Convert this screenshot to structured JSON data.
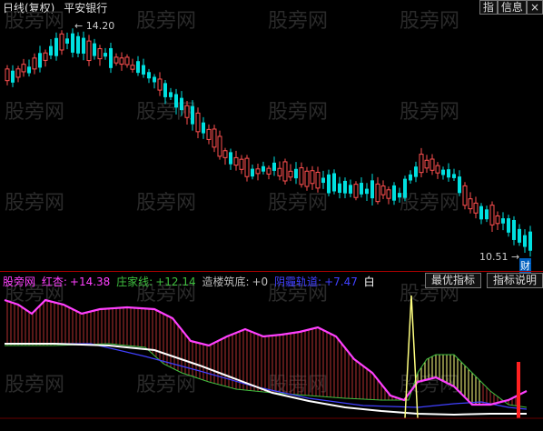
{
  "header": {
    "period": "日线(复权)",
    "stock_name": "平安银行",
    "btn_index": "指",
    "btn_info": "信息",
    "btn_close": "×",
    "watermark": "股旁网"
  },
  "price_chart": {
    "high_label": "14.20",
    "low_label": "10.51",
    "low_badge": "财",
    "colors": {
      "up": "#ff5050",
      "down": "#00e0e0"
    }
  },
  "indicator": {
    "name": "股旁网",
    "red_label": "红杏:",
    "red_value": "+14.38",
    "green_label": "庄家线:",
    "green_value": "+12.14",
    "zhuangdi_label": "造楼筑底:",
    "zhuangdi_value": "+0",
    "blue_label": "阴霾轨道:",
    "blue_value": "+7.47",
    "trailing": "白",
    "btn_best": "最优指标",
    "btn_help": "指标说明",
    "colors": {
      "red": "#ff40ff",
      "green": "#40c040",
      "blue": "#4040ff",
      "white": "#ffffff",
      "yellow": "#ffff80"
    }
  }
}
